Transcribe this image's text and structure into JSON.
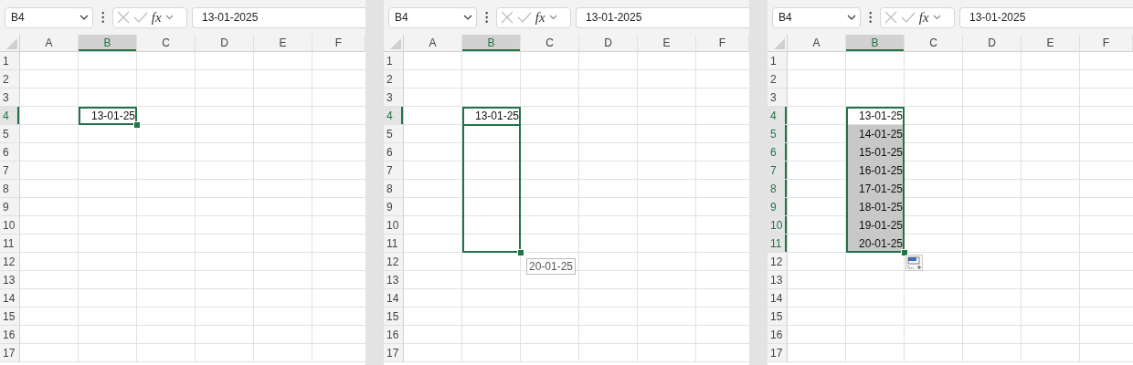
{
  "panels": [
    {
      "kind": "single",
      "name_box": "B4",
      "function_label": "fx",
      "formula": "13-01-2025",
      "columns": [
        {
          "label": "A",
          "selected": false
        },
        {
          "label": "B",
          "selected": true
        },
        {
          "label": "C",
          "selected": false
        },
        {
          "label": "D",
          "selected": false
        },
        {
          "label": "E",
          "selected": false
        },
        {
          "label": "F",
          "selected": false
        }
      ],
      "rows": [
        {
          "label": "1",
          "selected": false,
          "range": false
        },
        {
          "label": "2",
          "selected": false,
          "range": false
        },
        {
          "label": "3",
          "selected": false,
          "range": false
        },
        {
          "label": "4",
          "selected": true,
          "range": true,
          "cell": {
            "text": "13-01-25",
            "shaded": false
          }
        },
        {
          "label": "5",
          "selected": false,
          "range": false
        },
        {
          "label": "6",
          "selected": false,
          "range": false
        },
        {
          "label": "7",
          "selected": false,
          "range": false
        },
        {
          "label": "8",
          "selected": false,
          "range": false
        },
        {
          "label": "9",
          "selected": false,
          "range": false
        },
        {
          "label": "10",
          "selected": false,
          "range": false
        },
        {
          "label": "11",
          "selected": false,
          "range": false
        },
        {
          "label": "12",
          "selected": false,
          "range": false
        },
        {
          "label": "13",
          "selected": false,
          "range": false
        },
        {
          "label": "14",
          "selected": false,
          "range": false
        },
        {
          "label": "15",
          "selected": false,
          "range": false
        },
        {
          "label": "16",
          "selected": false,
          "range": false
        },
        {
          "label": "17",
          "selected": false,
          "range": false
        }
      ]
    },
    {
      "kind": "drag",
      "name_box": "B4",
      "function_label": "fx",
      "formula": "13-01-2025",
      "tooltip": "20-01-25",
      "columns": [
        {
          "label": "A",
          "selected": false
        },
        {
          "label": "B",
          "selected": true
        },
        {
          "label": "C",
          "selected": false
        },
        {
          "label": "D",
          "selected": false
        },
        {
          "label": "E",
          "selected": false
        },
        {
          "label": "F",
          "selected": false
        }
      ],
      "rows": [
        {
          "label": "1",
          "selected": false,
          "range": false
        },
        {
          "label": "2",
          "selected": false,
          "range": false
        },
        {
          "label": "3",
          "selected": false,
          "range": false
        },
        {
          "label": "4",
          "selected": true,
          "range": true,
          "cell": {
            "text": "13-01-25",
            "shaded": false
          }
        },
        {
          "label": "5",
          "selected": false,
          "range": true
        },
        {
          "label": "6",
          "selected": false,
          "range": true
        },
        {
          "label": "7",
          "selected": false,
          "range": true
        },
        {
          "label": "8",
          "selected": false,
          "range": true
        },
        {
          "label": "9",
          "selected": false,
          "range": true
        },
        {
          "label": "10",
          "selected": false,
          "range": true
        },
        {
          "label": "11",
          "selected": false,
          "range": true
        },
        {
          "label": "12",
          "selected": false,
          "range": false
        },
        {
          "label": "13",
          "selected": false,
          "range": false
        },
        {
          "label": "14",
          "selected": false,
          "range": false
        },
        {
          "label": "15",
          "selected": false,
          "range": false
        },
        {
          "label": "16",
          "selected": false,
          "range": false
        },
        {
          "label": "17",
          "selected": false,
          "range": false
        }
      ]
    },
    {
      "kind": "filled",
      "name_box": "B4",
      "function_label": "fx",
      "formula": "13-01-2025",
      "paste_options": true,
      "columns": [
        {
          "label": "A",
          "selected": false
        },
        {
          "label": "B",
          "selected": true
        },
        {
          "label": "C",
          "selected": false
        },
        {
          "label": "D",
          "selected": false
        },
        {
          "label": "E",
          "selected": false
        },
        {
          "label": "F",
          "selected": false
        }
      ],
      "rows": [
        {
          "label": "1",
          "selected": false,
          "range": false
        },
        {
          "label": "2",
          "selected": false,
          "range": false
        },
        {
          "label": "3",
          "selected": false,
          "range": false
        },
        {
          "label": "4",
          "selected": true,
          "range": true,
          "cell": {
            "text": "13-01-25",
            "shaded": false
          }
        },
        {
          "label": "5",
          "selected": true,
          "range": true,
          "cell": {
            "text": "14-01-25",
            "shaded": true
          }
        },
        {
          "label": "6",
          "selected": true,
          "range": true,
          "cell": {
            "text": "15-01-25",
            "shaded": true
          }
        },
        {
          "label": "7",
          "selected": true,
          "range": true,
          "cell": {
            "text": "16-01-25",
            "shaded": true
          }
        },
        {
          "label": "8",
          "selected": true,
          "range": true,
          "cell": {
            "text": "17-01-25",
            "shaded": true
          }
        },
        {
          "label": "9",
          "selected": true,
          "range": true,
          "cell": {
            "text": "18-01-25",
            "shaded": true
          }
        },
        {
          "label": "10",
          "selected": true,
          "range": true,
          "cell": {
            "text": "19-01-25",
            "shaded": true
          }
        },
        {
          "label": "11",
          "selected": true,
          "range": true,
          "cell": {
            "text": "20-01-25",
            "shaded": true
          }
        },
        {
          "label": "12",
          "selected": false,
          "range": false
        },
        {
          "label": "13",
          "selected": false,
          "range": false
        },
        {
          "label": "14",
          "selected": false,
          "range": false
        },
        {
          "label": "15",
          "selected": false,
          "range": false
        },
        {
          "label": "16",
          "selected": false,
          "range": false
        },
        {
          "label": "17",
          "selected": false,
          "range": false
        }
      ]
    }
  ]
}
